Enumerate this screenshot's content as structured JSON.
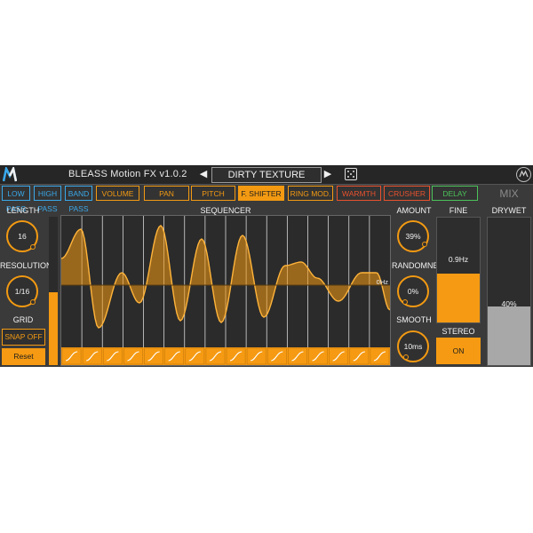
{
  "title": "BLEASS Motion FX  v1.0.2",
  "preset": {
    "name": "DIRTY TEXTURE",
    "prev_icon": "triangle-left",
    "next_icon": "triangle-right",
    "random_icon": "dice"
  },
  "tabs": [
    {
      "label": "LOW PASS",
      "color": "#3aa8ea",
      "active": false
    },
    {
      "label": "HIGH PASS",
      "color": "#3aa8ea",
      "active": false
    },
    {
      "label": "BAND PASS",
      "color": "#3aa8ea",
      "active": false
    },
    {
      "label": "VOLUME",
      "color": "#f39a12",
      "active": false
    },
    {
      "label": "PAN",
      "color": "#f39a12",
      "active": false
    },
    {
      "label": "PITCH",
      "color": "#f39a12",
      "active": false
    },
    {
      "label": "F. SHIFTER",
      "color": "#f39a12",
      "active": true
    },
    {
      "label": "RING MOD.",
      "color": "#f39a12",
      "active": false
    },
    {
      "label": "WARMTH",
      "color": "#e8512d",
      "active": false
    },
    {
      "label": "CRUSHER",
      "color": "#e8512d",
      "active": false
    },
    {
      "label": "DELAY",
      "color": "#4cc25a",
      "active": false
    }
  ],
  "mix": {
    "label": "MIX",
    "drywet_label": "DRYWET",
    "drywet_value": "40%",
    "drywet_fraction": 0.4
  },
  "left": {
    "length_label": "LENGTH",
    "length_value": "16",
    "resolution_label": "RESOLUTION",
    "resolution_value": "1/16",
    "grid_label": "GRID",
    "snap_label": "SNAP OFF",
    "reset_label": "Reset"
  },
  "sequencer": {
    "label": "SEQUENCER",
    "offset_label": "0Hz",
    "steps": 16,
    "level_fraction": 0.49
  },
  "right": {
    "amount_label": "AMOUNT",
    "amount_value": "39%",
    "randomness_label": "RANDOMNESS",
    "randomness_value": "0%",
    "smooth_label": "SMOOTH",
    "smooth_value": "10ms"
  },
  "fine": {
    "label": "FINE",
    "value": "0.9Hz",
    "fraction": 0.47
  },
  "stereo": {
    "label": "STEREO",
    "value": "ON"
  },
  "colors": {
    "accent": "#f39a12",
    "background": "#3a3a3a"
  }
}
